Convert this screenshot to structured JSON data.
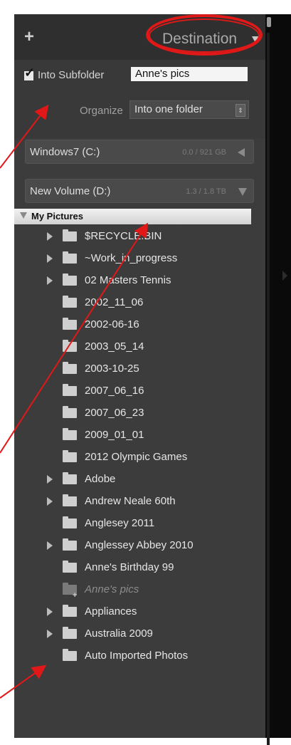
{
  "header": {
    "plus_symbol": "+",
    "title": "Destination"
  },
  "subfolder": {
    "checked": true,
    "label": "Into Subfolder",
    "value": "Anne's pics"
  },
  "organize": {
    "label": "Organize",
    "selected": "Into one folder"
  },
  "volumes": [
    {
      "name": "Windows7 (C:)",
      "size": "0.0 / 921 GB",
      "expanded": false
    },
    {
      "name": "New Volume (D:)",
      "size": "1.3 / 1.8 TB",
      "expanded": true
    }
  ],
  "root_folder": {
    "label": "My Pictures"
  },
  "folders": [
    {
      "label": "$RECYCLE.BIN",
      "expandable": true
    },
    {
      "label": "~Work_in_progress",
      "expandable": true
    },
    {
      "label": "02 Masters Tennis",
      "expandable": true
    },
    {
      "label": "2002_11_06",
      "expandable": false
    },
    {
      "label": "2002-06-16",
      "expandable": false
    },
    {
      "label": "2003_05_14",
      "expandable": false
    },
    {
      "label": "2003-10-25",
      "expandable": false
    },
    {
      "label": "2007_06_16",
      "expandable": false
    },
    {
      "label": "2007_06_23",
      "expandable": false
    },
    {
      "label": "2009_01_01",
      "expandable": false
    },
    {
      "label": "2012 Olympic Games",
      "expandable": false
    },
    {
      "label": "Adobe",
      "expandable": true
    },
    {
      "label": "Andrew Neale 60th",
      "expandable": true
    },
    {
      "label": "Anglesey 2011",
      "expandable": false
    },
    {
      "label": "Anglessey Abbey 2010",
      "expandable": true
    },
    {
      "label": "Anne's Birthday 99",
      "expandable": false
    },
    {
      "label": "Anne's pics",
      "expandable": false,
      "new": true
    },
    {
      "label": "Appliances",
      "expandable": true
    },
    {
      "label": "Australia 2009",
      "expandable": true
    },
    {
      "label": "Auto Imported Photos",
      "expandable": false
    }
  ],
  "colors": {
    "panel_bg": "#3c3c3c",
    "annotation_red": "#e01818",
    "highlight_row": "#e6e6e6"
  }
}
